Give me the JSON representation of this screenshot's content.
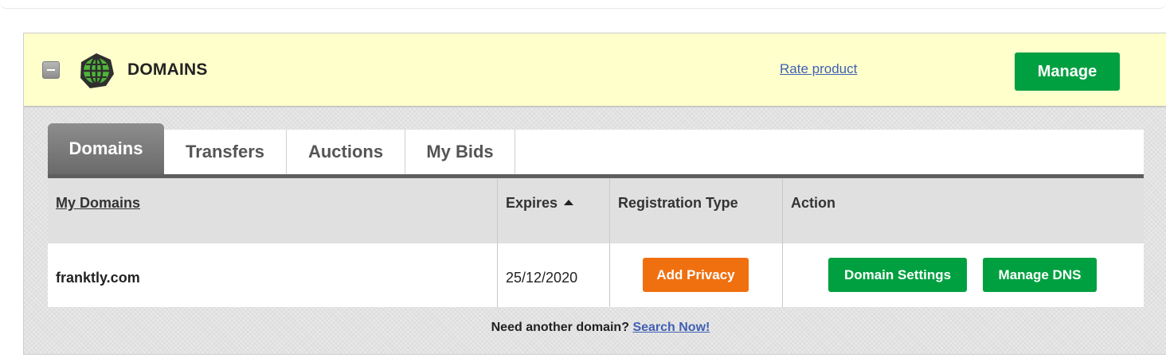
{
  "panel": {
    "title": "DOMAINS",
    "rate_link": "Rate product",
    "manage_label": "Manage"
  },
  "tabs": [
    {
      "label": "Domains",
      "active": true
    },
    {
      "label": "Transfers",
      "active": false
    },
    {
      "label": "Auctions",
      "active": false
    },
    {
      "label": "My Bids",
      "active": false
    }
  ],
  "table": {
    "columns": [
      "My Domains",
      "Expires",
      "Registration Type",
      "Action"
    ],
    "rows": [
      {
        "domain": "franktly.com",
        "expires": "25/12/2020",
        "privacy_button": "Add Privacy",
        "settings_button": "Domain Settings",
        "dns_button": "Manage DNS"
      }
    ]
  },
  "footer": {
    "prompt": "Need another domain?",
    "link": "Search Now!"
  },
  "colors": {
    "header_bg": "#ffffcc",
    "primary_green": "#00a040",
    "privacy_orange": "#f07010",
    "link_blue": "#4160b4"
  }
}
